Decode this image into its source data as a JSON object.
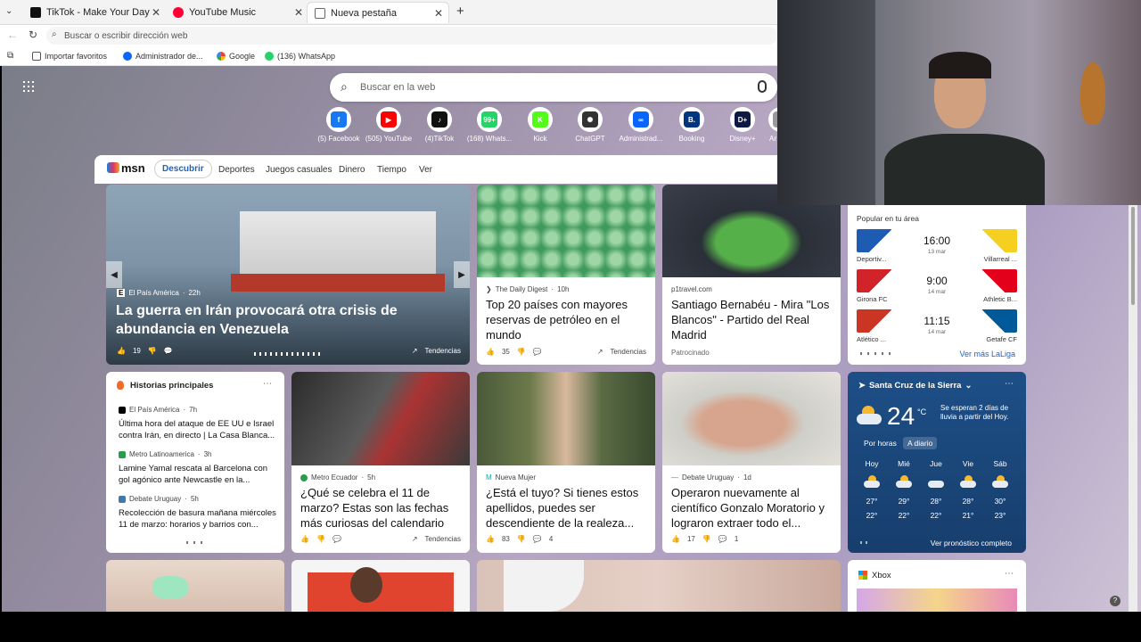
{
  "tabs": [
    {
      "label": "TikTok - Make Your Day",
      "color": "#111"
    },
    {
      "label": "YouTube Music",
      "color": "#ff0033"
    },
    {
      "label": "Nueva pestaña",
      "color": "#ffffff"
    }
  ],
  "address": {
    "placeholder": "Buscar o escribir dirección web"
  },
  "favorites": [
    "Importar favoritos",
    "Administrador de...",
    "Google",
    "(136) WhatsApp"
  ],
  "search": {
    "placeholder": "Buscar en la web"
  },
  "quicklinks": [
    {
      "label": "(5) Facebook",
      "icon": "facebook-icon",
      "color": "#1877f2",
      "glyph": "f"
    },
    {
      "label": "(505) YouTube",
      "icon": "youtube-icon",
      "color": "#ff0000",
      "glyph": "▶"
    },
    {
      "label": "(4)TikTok",
      "icon": "tiktok-icon",
      "color": "#111111",
      "glyph": "♪"
    },
    {
      "label": "(168) Whats...",
      "icon": "whatsapp-icon",
      "color": "#25d366",
      "glyph": "99+"
    },
    {
      "label": "Kick",
      "icon": "kick-icon",
      "color": "#53fc18",
      "glyph": "K"
    },
    {
      "label": "ChatGPT",
      "icon": "chatgpt-icon",
      "color": "#333333",
      "glyph": "✺"
    },
    {
      "label": "Administrad...",
      "icon": "meta-icon",
      "color": "#0866ff",
      "glyph": "∞"
    },
    {
      "label": "Booking",
      "icon": "booking-icon",
      "color": "#003580",
      "glyph": "B."
    },
    {
      "label": "Disney+",
      "icon": "disney-icon",
      "color": "#0e1a44",
      "glyph": "D+"
    },
    {
      "label": "Ar",
      "icon": "more-icon",
      "color": "#999999",
      "glyph": ""
    }
  ],
  "msn": {
    "logo": "msn",
    "tabs": [
      "Descubrir",
      "Deportes",
      "Juegos casuales",
      "Dinero",
      "Tiempo",
      "Ver"
    ]
  },
  "hero": {
    "source": "El País América",
    "time": "22h",
    "title": "La guerra en Irán provocará otra crisis de abundancia en Venezuela",
    "likes": "19",
    "trend": "Tendencias"
  },
  "card1": {
    "source": "The Daily Digest",
    "time": "10h",
    "title": "Top 20 países con mayores reservas de petróleo en el mundo",
    "likes": "35",
    "trend": "Tendencias"
  },
  "card2": {
    "source": "p1travel.com",
    "title": "Santiago Bernabéu - Mira \"Los Blancos\" - Partido del Real Madrid",
    "sponsored": "Patrocinado"
  },
  "sports": {
    "header": "Popular en tu área",
    "more": "Ver más LaLiga",
    "matches": [
      {
        "home": "Deportiv...",
        "away": "Villarreal ...",
        "time": "16:00",
        "date": "13 mar",
        "homeColor": "#1e5cb3",
        "awayColor": "#f5d020"
      },
      {
        "home": "Girona FC",
        "away": "Athletic B...",
        "time": "9:00",
        "date": "14 mar",
        "homeColor": "#d2232a",
        "awayColor": "#e3001b"
      },
      {
        "home": "Atlético ...",
        "away": "Getafe CF",
        "time": "11:15",
        "date": "14 mar",
        "homeColor": "#cb3524",
        "awayColor": "#005999"
      }
    ]
  },
  "top": {
    "header": "Historias principales",
    "items": [
      {
        "source": "El País América",
        "time": "7h",
        "title": "Última hora del ataque de EE UU e Israel contra Irán, en directo | La Casa Blanca..."
      },
      {
        "source": "Metro Latinoamerica",
        "time": "3h",
        "title": "Lamine Yamal rescata al Barcelona con gol agónico ante Newcastle en la..."
      },
      {
        "source": "Debate Uruguay",
        "time": "5h",
        "title": "Recolección de basura mañana miércoles 11 de marzo: horarios y barrios con..."
      }
    ]
  },
  "card3": {
    "source": "Metro Ecuador",
    "time": "5h",
    "title": "¿Qué se celebra el 11 de marzo? Estas son las fechas más curiosas del calendario",
    "trend": "Tendencias"
  },
  "card4": {
    "source": "Nueva Mujer",
    "title": "¿Está el tuyo? Si tienes estos apellidos, puedes ser descendiente de la realeza...",
    "likes": "83",
    "comments": "4"
  },
  "card5": {
    "source": "Debate Uruguay",
    "time": "1d",
    "title": "Operaron nuevamente al científico Gonzalo Moratorio y lograron extraer todo el...",
    "likes": "17",
    "comments": "1"
  },
  "weather": {
    "city": "Santa Cruz de la Sierra",
    "temp": "24",
    "unit": "°C",
    "alert": "Se esperan 2 días de lluvia a partir del Hoy.",
    "tabs": [
      "Por horas",
      "A diario"
    ],
    "link": "Ver pronóstico completo",
    "days": [
      {
        "d": "Hoy",
        "hi": "27°",
        "lo": "22°"
      },
      {
        "d": "Mié",
        "hi": "29°",
        "lo": "22°"
      },
      {
        "d": "Jue",
        "hi": "28°",
        "lo": "22°"
      },
      {
        "d": "Vie",
        "hi": "28°",
        "lo": "21°"
      },
      {
        "d": "Sáb",
        "hi": "30°",
        "lo": "23°"
      }
    ]
  },
  "xbox": {
    "label": "Xbox"
  }
}
